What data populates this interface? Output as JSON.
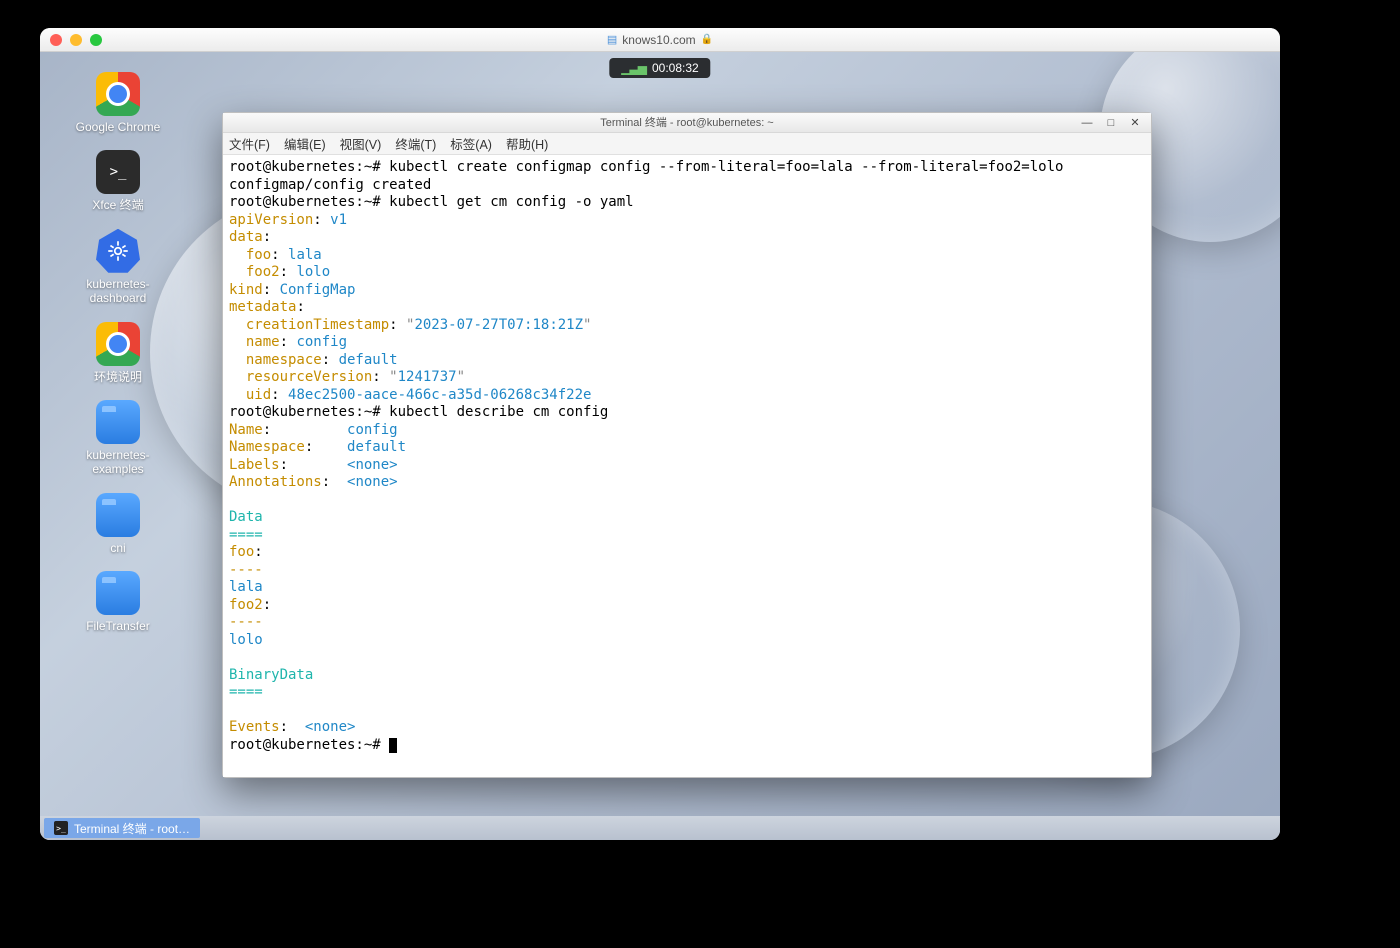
{
  "mac": {
    "url": "knows10.com"
  },
  "clock": "00:08:32",
  "desktop_icons": [
    {
      "id": "chrome",
      "label": "Google Chrome"
    },
    {
      "id": "xfce-term",
      "label": "Xfce 终端"
    },
    {
      "id": "k8s-dash",
      "label": "kubernetes-\ndashboard"
    },
    {
      "id": "env-desc",
      "label": "环境说明"
    },
    {
      "id": "k8s-examples",
      "label": "kubernetes-\nexamples"
    },
    {
      "id": "cni",
      "label": "cni"
    },
    {
      "id": "filetransfer",
      "label": "FileTransfer"
    }
  ],
  "terminal": {
    "title": "Terminal 终端 - root@kubernetes: ~",
    "menu": [
      "文件(F)",
      "编辑(E)",
      "视图(V)",
      "终端(T)",
      "标签(A)",
      "帮助(H)"
    ],
    "prompt": "root@kubernetes:~#",
    "cmd1": "kubectl create configmap config --from-literal=foo=lala --from-literal=foo2=lolo",
    "out1": "configmap/config created",
    "cmd2": "kubectl get cm config -o yaml",
    "yaml": {
      "apiVersion_key": "apiVersion",
      "apiVersion_val": "v1",
      "data_key": "data",
      "foo_key": "foo",
      "foo_val": "lala",
      "foo2_key": "foo2",
      "foo2_val": "lolo",
      "kind_key": "kind",
      "kind_val": "ConfigMap",
      "metadata_key": "metadata",
      "ct_key": "creationTimestamp",
      "ct_val": "2023-07-27T07:18:21Z",
      "name_key": "name",
      "name_val": "config",
      "ns_key": "namespace",
      "ns_val": "default",
      "rv_key": "resourceVersion",
      "rv_val": "1241737",
      "uid_key": "uid",
      "uid_val": "48ec2500-aace-466c-a35d-06268c34f22e"
    },
    "cmd3": "kubectl describe cm config",
    "describe": {
      "name_label": "Name",
      "name_val": "config",
      "ns_label": "Namespace",
      "ns_val": "default",
      "labels_label": "Labels",
      "labels_val": "<none>",
      "ann_label": "Annotations",
      "ann_val": "<none>",
      "data_hdr": "Data",
      "sep4": "====",
      "foo_k": "foo",
      "dashes": "----",
      "foo_v": "lala",
      "foo2_k": "foo2",
      "foo2_v": "lolo",
      "bin_hdr": "BinaryData",
      "events_label": "Events",
      "events_val": "<none>"
    }
  },
  "taskbar": {
    "item": "Terminal 终端 - root…"
  }
}
